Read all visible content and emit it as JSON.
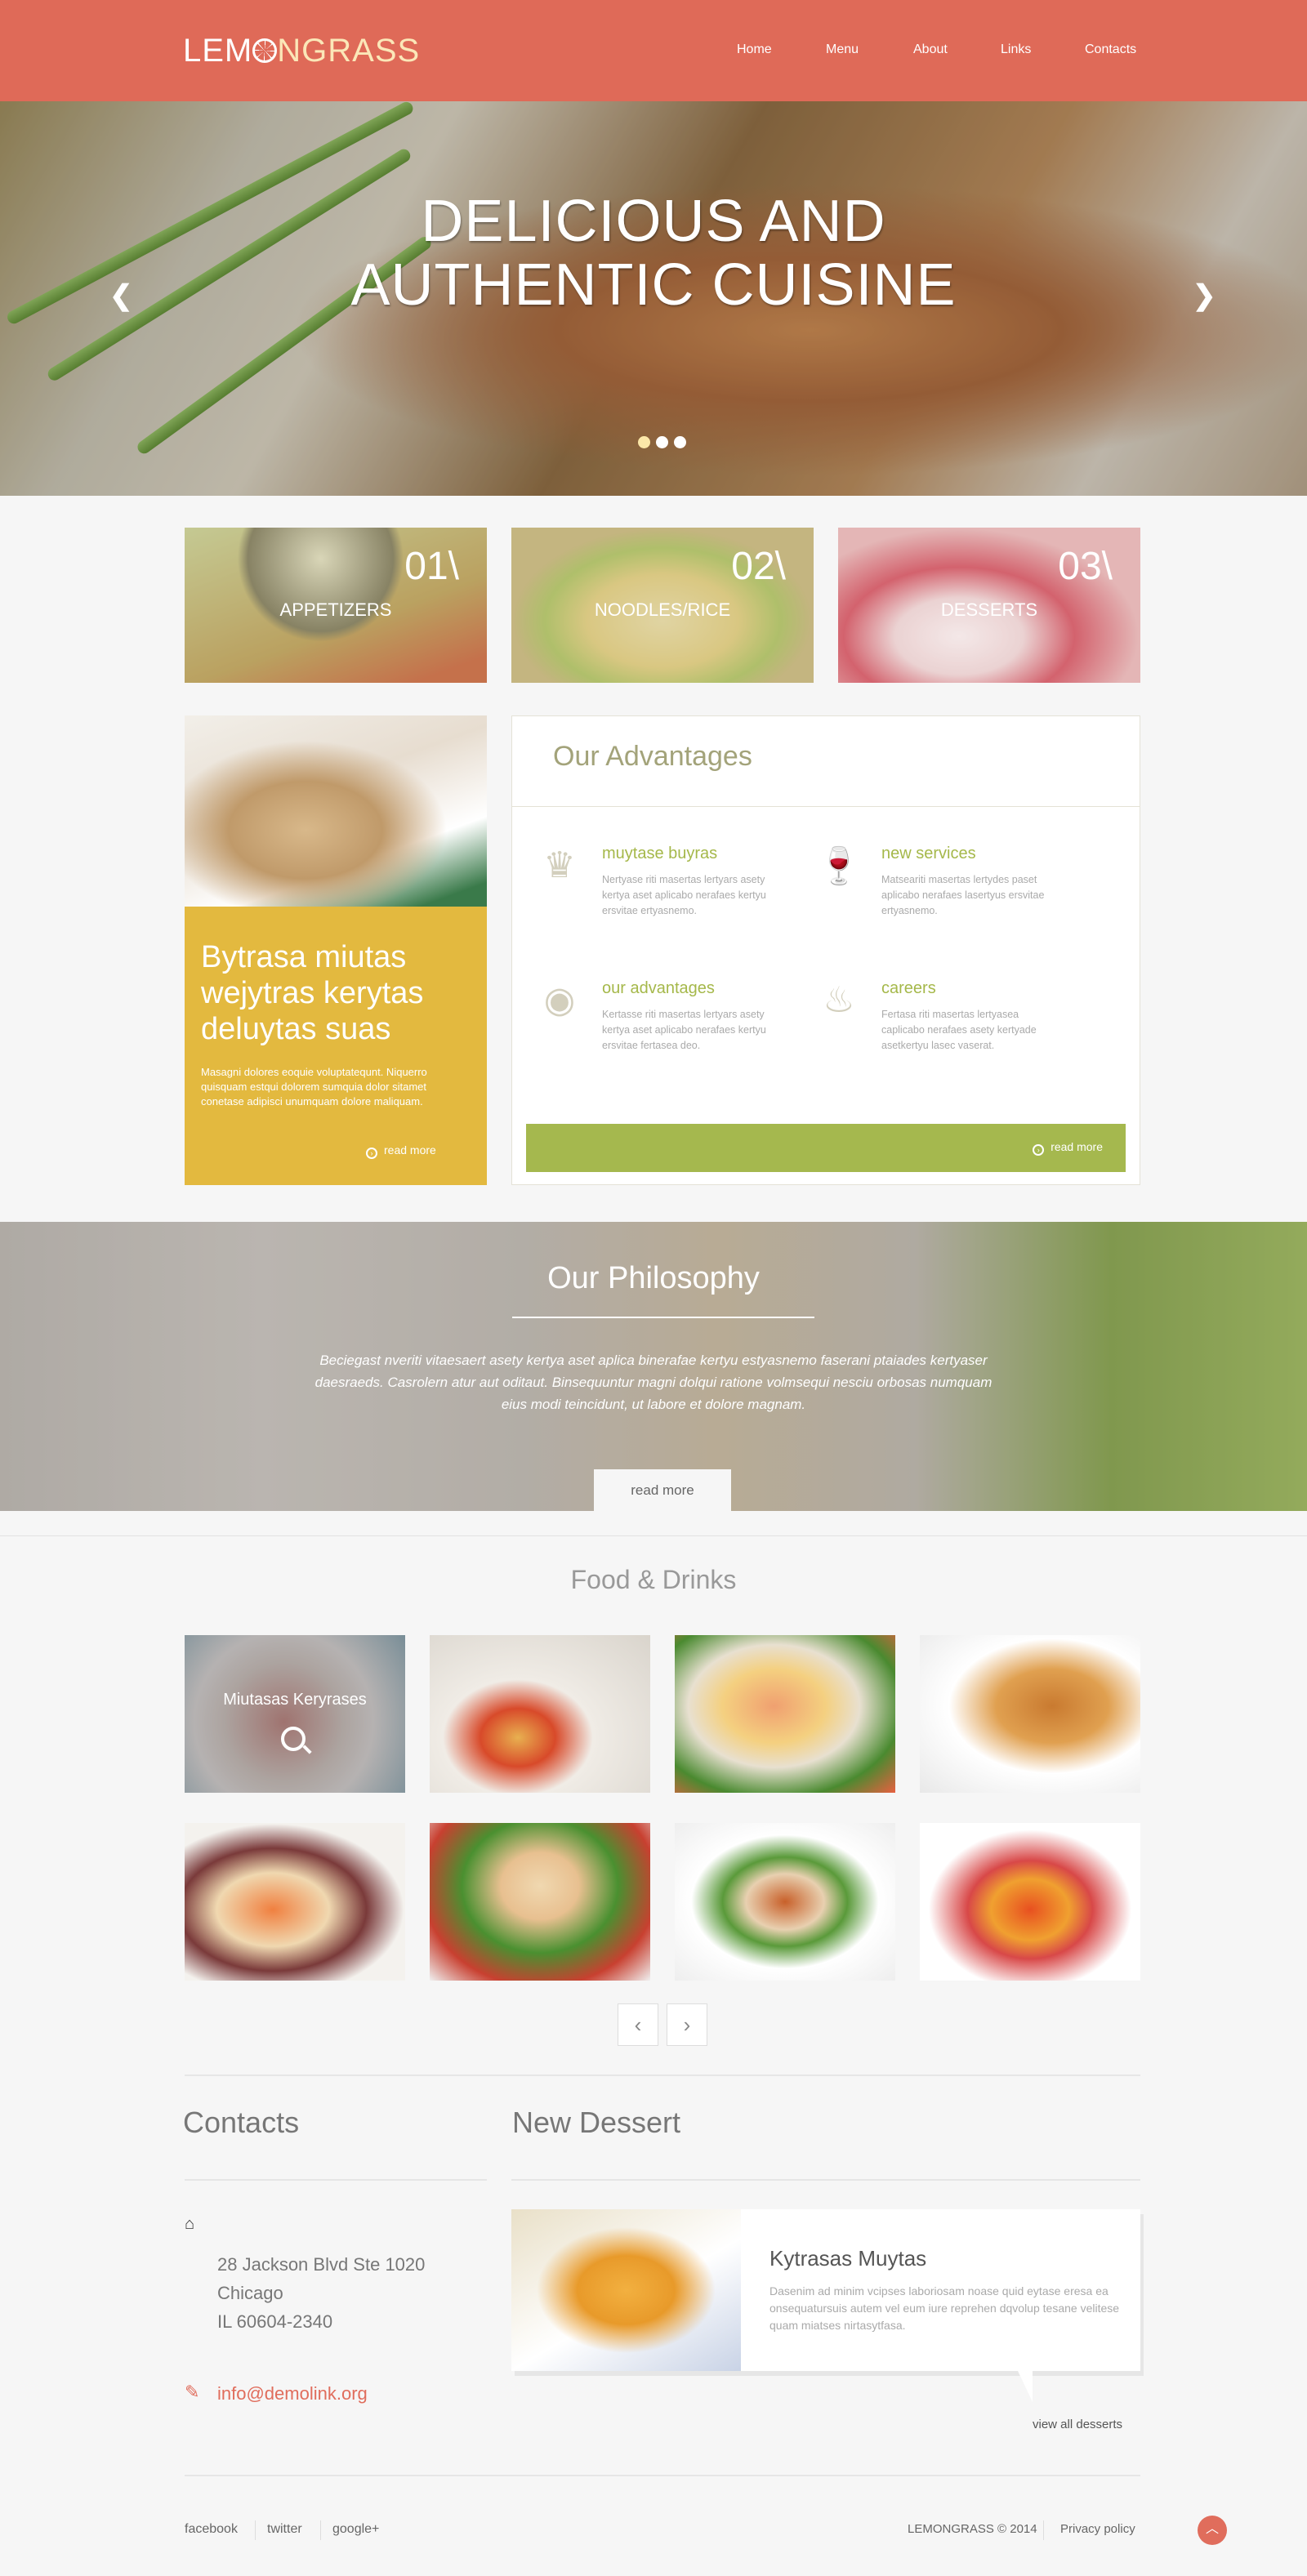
{
  "header": {
    "logo": {
      "part1": "LEM",
      "part2": "NGRASS"
    },
    "nav": [
      "Home",
      "Menu",
      "About",
      "Links",
      "Contacts"
    ]
  },
  "hero": {
    "title": "DELICIOUS AND AUTHENTIC CUISINE",
    "slides": 3,
    "active_slide": 0
  },
  "categories": [
    {
      "num": "01\\",
      "label": "APPETIZERS"
    },
    {
      "num": "02\\",
      "label": "NOODLES/RICE"
    },
    {
      "num": "03\\",
      "label": "DESSERTS"
    }
  ],
  "feature": {
    "title": "Bytrasa miutas wejytras kerytas deluytas suas",
    "text": "Masagni dolores eoquie voluptatequnt. Niquerro quisquam estqui dolorem sumquia dolor sitamet conetase adipisci unumquam dolore maliquam.",
    "read_more": "read more"
  },
  "advantages": {
    "title": "Our Advantages",
    "items": [
      {
        "icon": "chef-hat-icon",
        "title": "muytase buyras",
        "text": "Nertyase riti masertas lertyars asety kertya aset aplicabo nerafaes kertyu ersvitae ertyasnemo."
      },
      {
        "icon": "wine-icon",
        "title": "new services",
        "text": "Matseariti masertas lertydes paset aplicabo nerafaes lasertyus ersvitae ertyasnemo."
      },
      {
        "icon": "plate-cutlery-icon",
        "title": "our advantages",
        "text": "Kertasse riti masertas lertyars asety kertya aset aplicabo nerafaes kertyu ersvitae fertasea deo."
      },
      {
        "icon": "fish-dish-icon",
        "title": "careers",
        "text": "Fertasa riti masertas lertyasea caplicabo nerafaes asety kertyade asetkertyu lasec vaserat."
      }
    ],
    "read_more": "read more"
  },
  "philosophy": {
    "title": "Our Philosophy",
    "text": "Beciegast nveriti vitaesaert asety kertya aset aplica binerafae kertyu estyasnemo faserani ptaiades kertyaser daesraeds. Casrolern atur aut oditaut. Binsequuntur magni dolqui ratione volmsequi nesciu orbosas numquam eius modi teincidunt, ut labore et dolore magnam.",
    "read_more": "read more"
  },
  "food": {
    "title": "Food & Drinks",
    "hover_caption": "Miutasas Keryrases",
    "prev": "‹",
    "next": "›"
  },
  "contacts": {
    "title": "Contacts",
    "address": [
      "28 Jackson Blvd Ste 1020",
      "Chicago",
      "IL 60604-2340"
    ],
    "email": "info@demolink.org"
  },
  "dessert": {
    "section_title": "New Dessert",
    "title": "Kytrasas Muytas",
    "text": "Dasenim ad minim vcipses laboriosam noase quid eytase eresa ea onsequatursuis autem vel eum iure reprehen dqvolup tesane velitese quam miatses nirtasytfasa.",
    "view_all": "view all desserts"
  },
  "footer": {
    "social": [
      "facebook",
      "twitter",
      "google+"
    ],
    "copyright": "LEMONGRASS © 2014",
    "privacy": "Privacy policy"
  },
  "colors": {
    "header": "#df6a58",
    "yellow": "#e3b93f",
    "green": "#a5b84e",
    "accent": "#e06d5c"
  }
}
